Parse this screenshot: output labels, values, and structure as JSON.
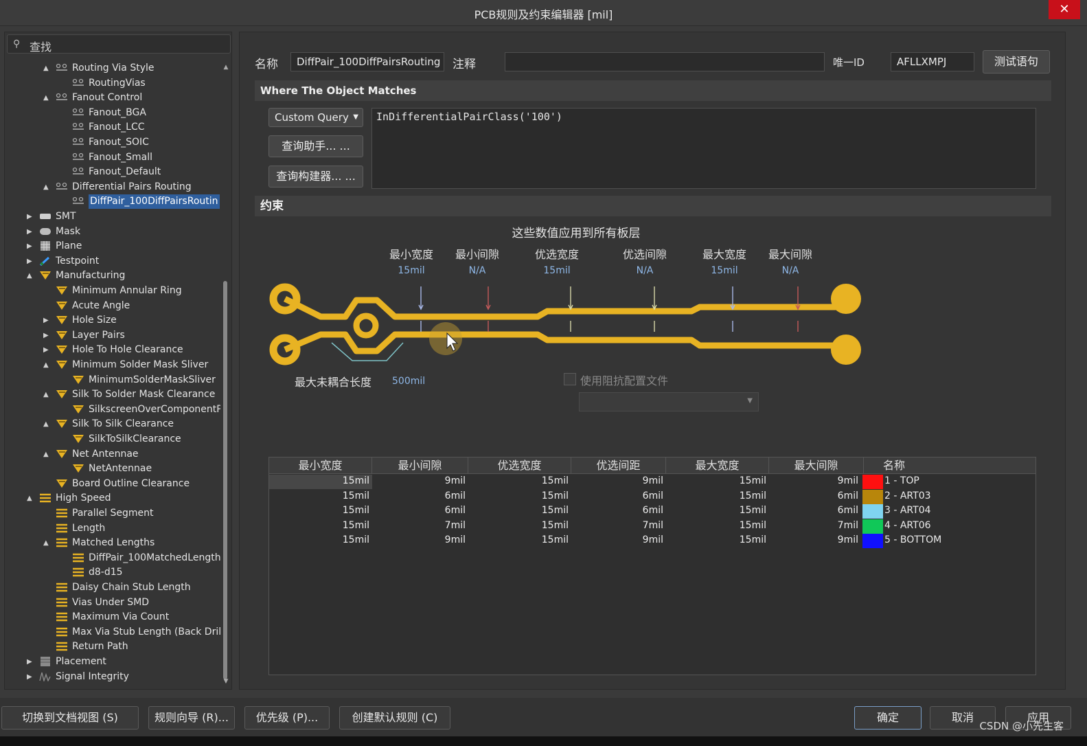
{
  "window": {
    "title": "PCB规则及约束编辑器 [mil]",
    "close_glyph": "✕"
  },
  "search": {
    "placeholder": "查找"
  },
  "tree": [
    {
      "label": "Routing Via Style",
      "indent": 2,
      "icon": "rule-icon",
      "arrow": "▲"
    },
    {
      "label": "RoutingVias",
      "indent": 3,
      "icon": "rule-icon",
      "arrow": ""
    },
    {
      "label": "Fanout Control",
      "indent": 2,
      "icon": "rule-icon",
      "arrow": "▲"
    },
    {
      "label": "Fanout_BGA",
      "indent": 3,
      "icon": "rule-icon",
      "arrow": ""
    },
    {
      "label": "Fanout_LCC",
      "indent": 3,
      "icon": "rule-icon",
      "arrow": ""
    },
    {
      "label": "Fanout_SOIC",
      "indent": 3,
      "icon": "rule-icon",
      "arrow": ""
    },
    {
      "label": "Fanout_Small",
      "indent": 3,
      "icon": "rule-icon",
      "arrow": ""
    },
    {
      "label": "Fanout_Default",
      "indent": 3,
      "icon": "rule-icon",
      "arrow": ""
    },
    {
      "label": "Differential Pairs Routing",
      "indent": 2,
      "icon": "rule-icon",
      "arrow": "▲"
    },
    {
      "label": "DiffPair_100DiffPairsRoutin",
      "indent": 3,
      "icon": "rule-icon",
      "arrow": "",
      "selected": true
    },
    {
      "label": "SMT",
      "indent": 1,
      "icon": "smt-icon",
      "arrow": "▶"
    },
    {
      "label": "Mask",
      "indent": 1,
      "icon": "mask-icon",
      "arrow": "▶"
    },
    {
      "label": "Plane",
      "indent": 1,
      "icon": "plane-icon",
      "arrow": "▶"
    },
    {
      "label": "Testpoint",
      "indent": 1,
      "icon": "testpoint-icon",
      "arrow": "▶"
    },
    {
      "label": "Manufacturing",
      "indent": 1,
      "icon": "manufacturing-icon",
      "arrow": "▲"
    },
    {
      "label": "Minimum Annular Ring",
      "indent": 2,
      "icon": "manufacturing-icon",
      "arrow": ""
    },
    {
      "label": "Acute Angle",
      "indent": 2,
      "icon": "manufacturing-icon",
      "arrow": ""
    },
    {
      "label": "Hole Size",
      "indent": 2,
      "icon": "manufacturing-icon",
      "arrow": "▶"
    },
    {
      "label": "Layer Pairs",
      "indent": 2,
      "icon": "manufacturing-icon",
      "arrow": "▶"
    },
    {
      "label": "Hole To Hole Clearance",
      "indent": 2,
      "icon": "manufacturing-icon",
      "arrow": "▶"
    },
    {
      "label": "Minimum Solder Mask Sliver",
      "indent": 2,
      "icon": "manufacturing-icon",
      "arrow": "▲"
    },
    {
      "label": "MinimumSolderMaskSliver",
      "indent": 3,
      "icon": "manufacturing-icon",
      "arrow": ""
    },
    {
      "label": "Silk To Solder Mask Clearance",
      "indent": 2,
      "icon": "manufacturing-icon",
      "arrow": "▲"
    },
    {
      "label": "SilkscreenOverComponentP",
      "indent": 3,
      "icon": "manufacturing-icon",
      "arrow": ""
    },
    {
      "label": "Silk To Silk Clearance",
      "indent": 2,
      "icon": "manufacturing-icon",
      "arrow": "▲"
    },
    {
      "label": "SilkToSilkClearance",
      "indent": 3,
      "icon": "manufacturing-icon",
      "arrow": ""
    },
    {
      "label": "Net Antennae",
      "indent": 2,
      "icon": "manufacturing-icon",
      "arrow": "▲"
    },
    {
      "label": "NetAntennae",
      "indent": 3,
      "icon": "manufacturing-icon",
      "arrow": ""
    },
    {
      "label": "Board Outline Clearance",
      "indent": 2,
      "icon": "manufacturing-icon",
      "arrow": ""
    },
    {
      "label": "High Speed",
      "indent": 1,
      "icon": "highspeed-icon",
      "arrow": "▲"
    },
    {
      "label": "Parallel Segment",
      "indent": 2,
      "icon": "highspeed-icon",
      "arrow": ""
    },
    {
      "label": "Length",
      "indent": 2,
      "icon": "highspeed-icon",
      "arrow": ""
    },
    {
      "label": "Matched Lengths",
      "indent": 2,
      "icon": "highspeed-icon",
      "arrow": "▲"
    },
    {
      "label": "DiffPair_100MatchedLength",
      "indent": 3,
      "icon": "highspeed-icon",
      "arrow": ""
    },
    {
      "label": "d8-d15",
      "indent": 3,
      "icon": "highspeed-icon",
      "arrow": ""
    },
    {
      "label": "Daisy Chain Stub Length",
      "indent": 2,
      "icon": "highspeed-icon",
      "arrow": ""
    },
    {
      "label": "Vias Under SMD",
      "indent": 2,
      "icon": "highspeed-icon",
      "arrow": ""
    },
    {
      "label": "Maximum Via Count",
      "indent": 2,
      "icon": "highspeed-icon",
      "arrow": ""
    },
    {
      "label": "Max Via Stub Length (Back Drill",
      "indent": 2,
      "icon": "highspeed-icon",
      "arrow": ""
    },
    {
      "label": "Return Path",
      "indent": 2,
      "icon": "highspeed-icon",
      "arrow": ""
    },
    {
      "label": "Placement",
      "indent": 1,
      "icon": "placement-icon",
      "arrow": "▶"
    },
    {
      "label": "Signal Integrity",
      "indent": 1,
      "icon": "signal-integrity-icon",
      "arrow": "▶"
    }
  ],
  "rule": {
    "name_label": "名称",
    "name_value": "DiffPair_100DiffPairsRouting",
    "comment_label": "注释",
    "comment_value": "",
    "uid_label": "唯一ID",
    "uid_value": "AFLLXMPJ",
    "test_button": "测试语句"
  },
  "where": {
    "heading": "Where The Object Matches",
    "query_type": "Custom Query",
    "query_helper": "查询助手... ...",
    "query_builder": "查询构建器... ...",
    "query_text": "InDifferentialPairClass('100')"
  },
  "constraints": {
    "heading": "约束",
    "apply_all": "这些数值应用到所有板层",
    "columns": [
      {
        "label": "最小宽度",
        "value": "15mil"
      },
      {
        "label": "最小间隙",
        "value": "N/A"
      },
      {
        "label": "优选宽度",
        "value": "15mil"
      },
      {
        "label": "优选间隙",
        "value": "N/A"
      },
      {
        "label": "最大宽度",
        "value": "15mil"
      },
      {
        "label": "最大间隙",
        "value": "N/A"
      }
    ],
    "uncoupled_label": "最大未耦合长度",
    "uncoupled_value": "500mil",
    "impedance_label": "使用阻抗配置文件",
    "trace_color": "#e8b323"
  },
  "layer_table": {
    "headers": [
      "最小宽度",
      "最小间隙",
      "优选宽度",
      "优选间距",
      "最大宽度",
      "最大间隙",
      "名称"
    ],
    "rows": [
      {
        "cells": [
          "15mil",
          "9mil",
          "15mil",
          "9mil",
          "15mil",
          "9mil"
        ],
        "color": "#ff1010",
        "name": "1 - TOP"
      },
      {
        "cells": [
          "15mil",
          "6mil",
          "15mil",
          "6mil",
          "15mil",
          "6mil"
        ],
        "color": "#b8860b",
        "name": "2 - ART03"
      },
      {
        "cells": [
          "15mil",
          "6mil",
          "15mil",
          "6mil",
          "15mil",
          "6mil"
        ],
        "color": "#7fd4f0",
        "name": "3 - ART04"
      },
      {
        "cells": [
          "15mil",
          "7mil",
          "15mil",
          "7mil",
          "15mil",
          "7mil"
        ],
        "color": "#10c858",
        "name": "4 - ART06"
      },
      {
        "cells": [
          "15mil",
          "9mil",
          "15mil",
          "9mil",
          "15mil",
          "9mil"
        ],
        "color": "#1010ff",
        "name": "5 - BOTTOM"
      }
    ]
  },
  "footer": {
    "buttons": [
      "切换到文档视图 (S)",
      "规则向导 (R)...",
      "优先级 (P)...",
      "创建默认规则 (C)"
    ],
    "ok": "确定",
    "cancel": "取消",
    "apply": "应用",
    "watermark": "CSDN @小先生客"
  }
}
